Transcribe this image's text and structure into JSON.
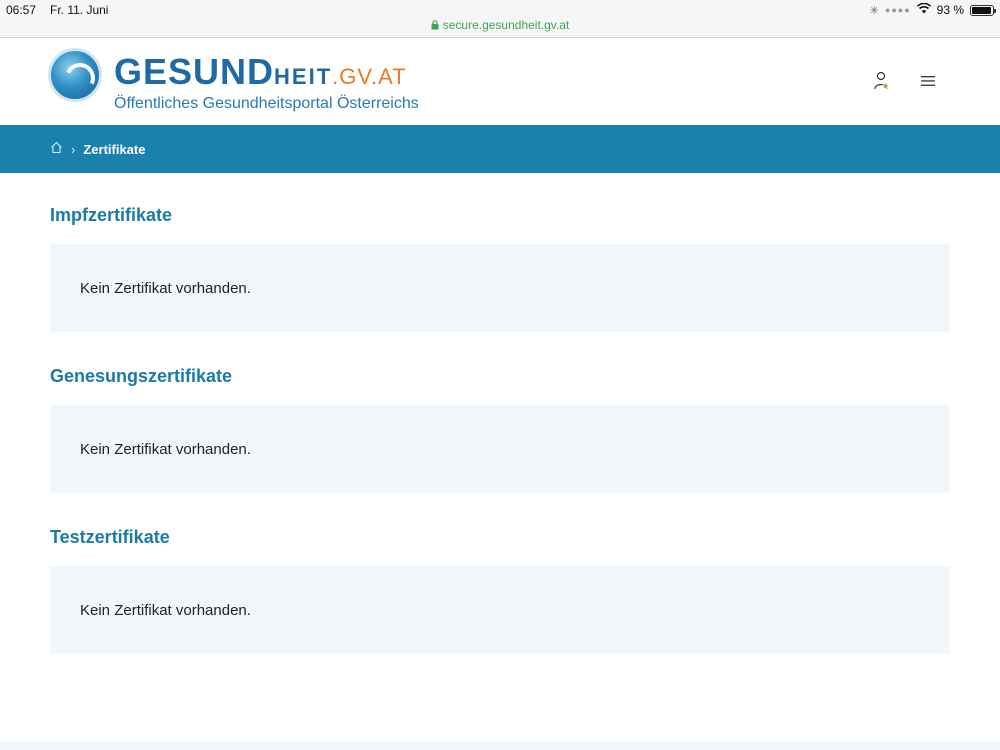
{
  "status_bar": {
    "time": "06:57",
    "date": "Fr. 11. Juni",
    "battery": "93 %"
  },
  "browser": {
    "url": "secure.gesundheit.gv.at"
  },
  "header": {
    "logo_gesund": "GESUND",
    "logo_heit": "HEIT",
    "logo_domain": ".GV.AT",
    "logo_subtitle": "Öffentliches Gesundheitsportal Österreichs",
    "icons": [
      "user-icon",
      "menu-icon"
    ]
  },
  "breadcrumb": {
    "current": "Zertifikate"
  },
  "sections": [
    {
      "title": "Impfzertifikate",
      "message": "Kein Zertifikat vorhanden."
    },
    {
      "title": "Genesungszertifikate",
      "message": "Kein Zertifikat vorhanden."
    },
    {
      "title": "Testzertifikate",
      "message": "Kein Zertifikat vorhanden."
    }
  ],
  "colors": {
    "accent": "#1a80ad",
    "heading": "#1a7aa8",
    "card_bg": "#f2f7fb",
    "url_secure": "#3aa655"
  }
}
